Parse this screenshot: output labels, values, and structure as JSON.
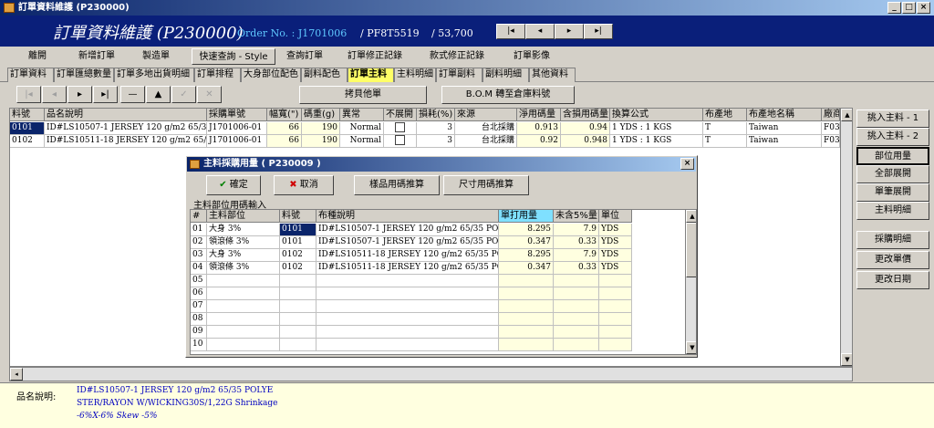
{
  "window": {
    "title": "訂單資料維護 (P230000)"
  },
  "header": {
    "title": "訂單資料維護 (P230000)",
    "order_label": "Order No. : J1701006",
    "pf": "/ PF8T5519",
    "qty": "/ 53,700",
    "nav": [
      "|◂",
      "◂",
      "▸",
      "▸|"
    ]
  },
  "menu": [
    "離開",
    "新增訂單",
    "製造單",
    "快速查詢 - Style No.",
    "查詢訂單",
    "訂單修正記錄",
    "款式修正記錄",
    "訂單影像"
  ],
  "tabs": [
    "訂單資料",
    "訂單匯總數量",
    "訂單多地出貨明細",
    "訂單排程",
    "大身部位配色",
    "副料配色",
    "訂單主料",
    "主料明細",
    "訂單副料",
    "副料明細",
    "其他資料"
  ],
  "toolbar": {
    "nav": [
      "|◂",
      "◂",
      "▸",
      "▸|",
      "—",
      "▲",
      "✓",
      "✕"
    ],
    "copy_btn": "拷貝他單",
    "bom_btn": "B.O.M 轉至倉庫料號"
  },
  "grid": {
    "headers": [
      "料號",
      "品名說明",
      "採購單號",
      "幅寬(\")",
      "碼重(g)",
      "異常",
      "不展開",
      "損耗(%)",
      "來源",
      "淨用碼量",
      "含損用碼量",
      "換算公式",
      "布產地",
      "布產地名稱",
      "廠商"
    ],
    "rows": [
      [
        "0101",
        "ID#LS10507-1 JERSEY 120 g/m2 65/35 POLY",
        "J1701006-01",
        "66",
        "190",
        "Normal",
        "",
        "3",
        "台北採購",
        "0.913",
        "0.94",
        "1 YDS : 1 KGS",
        "T",
        "Taiwan",
        "F032"
      ],
      [
        "0102",
        "ID#LS10511-18 JERSEY 120 g/m2 65/35 POLY",
        "J1701006-01",
        "66",
        "190",
        "Normal",
        "",
        "3",
        "台北採購",
        "0.92",
        "0.948",
        "1 YDS : 1 KGS",
        "T",
        "Taiwan",
        "F032"
      ]
    ]
  },
  "side_buttons": [
    "挑入主料 - 1",
    "挑入主料 - 2",
    "部位用量",
    "全部展開",
    "單筆展開",
    "主料明細",
    "採購明細",
    "更改單價",
    "更改日期"
  ],
  "footer": {
    "label": "品名說明:",
    "lines": [
      "ID#LS10507-1 JERSEY 120 g/m2 65/35 POLYE",
      "STER/RAYON W/WICKING30S/1,22G Shrinkage",
      "-6%X-6% Skew -5%"
    ]
  },
  "dialog": {
    "title": "主料採購用量 ( P230009 )",
    "ok": "確定",
    "cancel": "取消",
    "sample_calc": "樣品用碼推算",
    "size_calc": "尺寸用碼推算",
    "group_label": "主料部位用碼輸入",
    "headers": [
      "#",
      "主料部位",
      "料號",
      "布種說明",
      "單打用量",
      "未含5%量",
      "單位"
    ],
    "rows": [
      [
        "01",
        "大身 3%",
        "0101",
        "ID#LS10507-1 JERSEY 120 g/m2 65/35 POLYE",
        "8.295",
        "7.9",
        "YDS"
      ],
      [
        "02",
        "領滾條 3%",
        "0101",
        "ID#LS10507-1 JERSEY 120 g/m2 65/35 POLYE",
        "0.347",
        "0.33",
        "YDS"
      ],
      [
        "03",
        "大身 3%",
        "0102",
        "ID#LS10511-18 JERSEY 120 g/m2 65/35 POLYE",
        "8.295",
        "7.9",
        "YDS"
      ],
      [
        "04",
        "領滾條 3%",
        "0102",
        "ID#LS10511-18 JERSEY 120 g/m2 65/35 POLYE",
        "0.347",
        "0.33",
        "YDS"
      ],
      [
        "05",
        "",
        "",
        "",
        "",
        "",
        ""
      ],
      [
        "06",
        "",
        "",
        "",
        "",
        "",
        ""
      ],
      [
        "07",
        "",
        "",
        "",
        "",
        "",
        ""
      ],
      [
        "08",
        "",
        "",
        "",
        "",
        "",
        ""
      ],
      [
        "09",
        "",
        "",
        "",
        "",
        "",
        ""
      ],
      [
        "10",
        "",
        "",
        "",
        "",
        "",
        ""
      ]
    ]
  },
  "colors": {
    "header_bg": "#0a1f7a",
    "order_text": "#5fc8ff",
    "active_tab": "#ffff66",
    "highlight": "#ffffe0",
    "selected_cell": "#0a246a"
  }
}
